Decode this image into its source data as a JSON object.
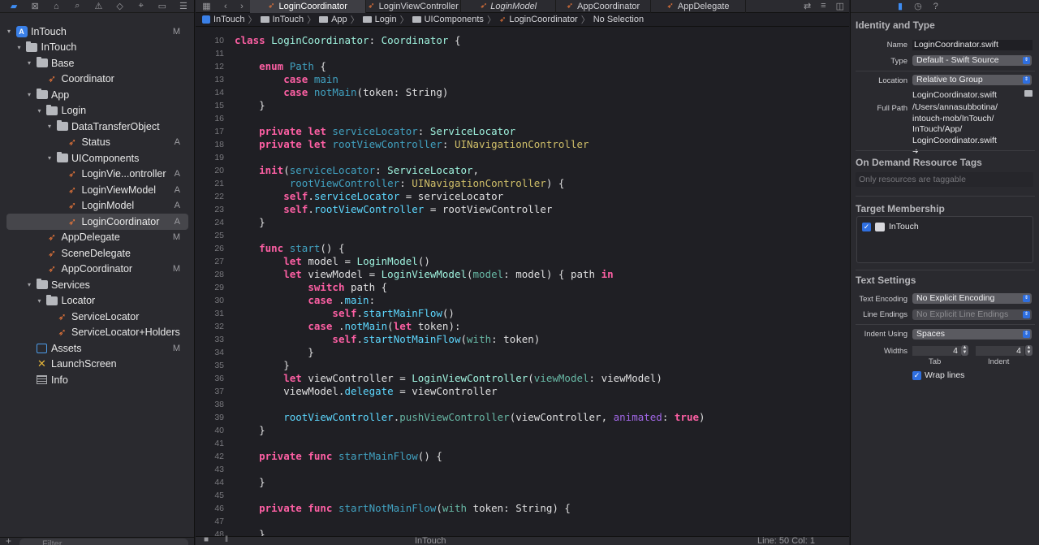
{
  "navigator": {
    "toolbar_icons": [
      "folder-icon",
      "source-control-icon",
      "hierarchy-icon",
      "search-icon",
      "warning-icon",
      "test-icon",
      "debug-icon",
      "breakpoint-icon",
      "report-icon"
    ],
    "items": [
      {
        "name": "InTouch",
        "kind": "project",
        "level": 0,
        "open": true,
        "badge": "M"
      },
      {
        "name": "InTouch",
        "kind": "folder",
        "level": 1,
        "open": true,
        "badge": ""
      },
      {
        "name": "Base",
        "kind": "folder",
        "level": 2,
        "open": true,
        "badge": ""
      },
      {
        "name": "Coordinator",
        "kind": "swift",
        "level": 3,
        "badge": ""
      },
      {
        "name": "App",
        "kind": "folder",
        "level": 2,
        "open": true,
        "badge": ""
      },
      {
        "name": "Login",
        "kind": "folder",
        "level": 3,
        "open": true,
        "badge": ""
      },
      {
        "name": "DataTransferObject",
        "kind": "folder",
        "level": 4,
        "open": true,
        "badge": ""
      },
      {
        "name": "Status",
        "kind": "swift",
        "level": 5,
        "badge": "A"
      },
      {
        "name": "UIComponents",
        "kind": "folder",
        "level": 4,
        "open": true,
        "badge": ""
      },
      {
        "name": "LoginVie...ontroller",
        "kind": "swift",
        "level": 5,
        "badge": "A"
      },
      {
        "name": "LoginViewModel",
        "kind": "swift",
        "level": 5,
        "badge": "A"
      },
      {
        "name": "LoginModel",
        "kind": "swift",
        "level": 5,
        "badge": "A"
      },
      {
        "name": "LoginCoordinator",
        "kind": "swift",
        "level": 5,
        "badge": "A",
        "selected": true
      },
      {
        "name": "AppDelegate",
        "kind": "swift",
        "level": 3,
        "badge": "M"
      },
      {
        "name": "SceneDelegate",
        "kind": "swift",
        "level": 3,
        "badge": ""
      },
      {
        "name": "AppCoordinator",
        "kind": "swift",
        "level": 3,
        "badge": "M"
      },
      {
        "name": "Services",
        "kind": "folder",
        "level": 2,
        "open": true,
        "badge": ""
      },
      {
        "name": "Locator",
        "kind": "folder",
        "level": 3,
        "open": true,
        "badge": ""
      },
      {
        "name": "ServiceLocator",
        "kind": "swift",
        "level": 4,
        "badge": ""
      },
      {
        "name": "ServiceLocator+Holders",
        "kind": "swift",
        "level": 4,
        "badge": ""
      },
      {
        "name": "Assets",
        "kind": "assets",
        "level": 2,
        "badge": "M"
      },
      {
        "name": "LaunchScreen",
        "kind": "launch",
        "level": 2,
        "badge": ""
      },
      {
        "name": "Info",
        "kind": "info",
        "level": 2,
        "badge": ""
      }
    ],
    "filter_placeholder": "Filter"
  },
  "tabs": [
    {
      "label": "LoginCoordinator",
      "active": true,
      "italic": false
    },
    {
      "label": "LoginViewController",
      "active": false,
      "italic": false
    },
    {
      "label": "LoginModel",
      "active": false,
      "italic": true
    },
    {
      "label": "AppCoordinator",
      "active": false,
      "italic": false
    },
    {
      "label": "AppDelegate",
      "active": false,
      "italic": false
    }
  ],
  "jumpbar": [
    {
      "label": "InTouch",
      "kind": "project"
    },
    {
      "label": "InTouch",
      "kind": "folder"
    },
    {
      "label": "App",
      "kind": "folder"
    },
    {
      "label": "Login",
      "kind": "folder"
    },
    {
      "label": "UIComponents",
      "kind": "folder"
    },
    {
      "label": "LoginCoordinator",
      "kind": "swift"
    },
    {
      "label": "No Selection",
      "kind": "text"
    }
  ],
  "code": [
    {
      "n": "10",
      "t": [
        [
          "kw",
          "class "
        ],
        [
          "tycls",
          "LoginCoordinator"
        ],
        [
          "pl",
          ": "
        ],
        [
          "tycls",
          "Coordinator"
        ],
        [
          "pl",
          " {"
        ]
      ]
    },
    {
      "n": "11",
      "t": []
    },
    {
      "n": "12",
      "t": [
        [
          "pl",
          "    "
        ],
        [
          "kw",
          "enum "
        ],
        [
          "dec",
          "Path"
        ],
        [
          "pl",
          " {"
        ]
      ]
    },
    {
      "n": "13",
      "t": [
        [
          "pl",
          "        "
        ],
        [
          "kw",
          "case "
        ],
        [
          "dec",
          "main"
        ]
      ]
    },
    {
      "n": "14",
      "t": [
        [
          "pl",
          "        "
        ],
        [
          "kw",
          "case "
        ],
        [
          "dec",
          "notMain"
        ],
        [
          "pl",
          "(token: String)"
        ]
      ]
    },
    {
      "n": "15",
      "t": [
        [
          "pl",
          "    }"
        ]
      ]
    },
    {
      "n": "16",
      "t": []
    },
    {
      "n": "17",
      "t": [
        [
          "pl",
          "    "
        ],
        [
          "kw",
          "private let "
        ],
        [
          "dec",
          "serviceLocator"
        ],
        [
          "pl",
          ": "
        ],
        [
          "tycls",
          "ServiceLocator"
        ]
      ]
    },
    {
      "n": "18",
      "t": [
        [
          "pl",
          "    "
        ],
        [
          "kw",
          "private let "
        ],
        [
          "dec",
          "rootViewController"
        ],
        [
          "pl",
          ": "
        ],
        [
          "ty",
          "UINavigationController"
        ]
      ]
    },
    {
      "n": "19",
      "t": []
    },
    {
      "n": "20",
      "t": [
        [
          "pl",
          "    "
        ],
        [
          "kw",
          "init"
        ],
        [
          "pl",
          "("
        ],
        [
          "dec",
          "serviceLocator"
        ],
        [
          "pl",
          ": "
        ],
        [
          "tycls",
          "ServiceLocator"
        ],
        [
          "pl",
          ","
        ]
      ]
    },
    {
      "n": "21",
      "t": [
        [
          "pl",
          "         "
        ],
        [
          "dec",
          "rootViewController"
        ],
        [
          "pl",
          ": "
        ],
        [
          "ty",
          "UINavigationController"
        ],
        [
          "pl",
          ") {"
        ]
      ]
    },
    {
      "n": "22",
      "t": [
        [
          "pl",
          "        "
        ],
        [
          "kw",
          "self"
        ],
        [
          "pl",
          "."
        ],
        [
          "ut",
          "serviceLocator"
        ],
        [
          "pl",
          " = serviceLocator"
        ]
      ]
    },
    {
      "n": "23",
      "t": [
        [
          "pl",
          "        "
        ],
        [
          "kw",
          "self"
        ],
        [
          "pl",
          "."
        ],
        [
          "ut",
          "rootViewController"
        ],
        [
          "pl",
          " = rootViewController"
        ]
      ]
    },
    {
      "n": "24",
      "t": [
        [
          "pl",
          "    }"
        ]
      ]
    },
    {
      "n": "25",
      "t": []
    },
    {
      "n": "26",
      "t": [
        [
          "pl",
          "    "
        ],
        [
          "kw",
          "func "
        ],
        [
          "dec",
          "start"
        ],
        [
          "pl",
          "() {"
        ]
      ]
    },
    {
      "n": "27",
      "t": [
        [
          "pl",
          "        "
        ],
        [
          "kw",
          "let "
        ],
        [
          "pl",
          "model = "
        ],
        [
          "tycls",
          "LoginModel"
        ],
        [
          "pl",
          "()"
        ]
      ]
    },
    {
      "n": "28",
      "t": [
        [
          "pl",
          "        "
        ],
        [
          "kw",
          "let "
        ],
        [
          "pl",
          "viewModel = "
        ],
        [
          "tycls",
          "LoginViewModel"
        ],
        [
          "pl",
          "("
        ],
        [
          "fn",
          "model"
        ],
        [
          "pl",
          ": model) { path "
        ],
        [
          "kw",
          "in"
        ]
      ]
    },
    {
      "n": "29",
      "t": [
        [
          "pl",
          "            "
        ],
        [
          "kw",
          "switch "
        ],
        [
          "pl",
          "path {"
        ]
      ]
    },
    {
      "n": "30",
      "t": [
        [
          "pl",
          "            "
        ],
        [
          "kw",
          "case "
        ],
        [
          "pl",
          "."
        ],
        [
          "ut",
          "main"
        ],
        [
          "pl",
          ":"
        ]
      ]
    },
    {
      "n": "31",
      "t": [
        [
          "pl",
          "                "
        ],
        [
          "kw",
          "self"
        ],
        [
          "pl",
          "."
        ],
        [
          "ut",
          "startMainFlow"
        ],
        [
          "pl",
          "()"
        ]
      ]
    },
    {
      "n": "32",
      "t": [
        [
          "pl",
          "            "
        ],
        [
          "kw",
          "case "
        ],
        [
          "pl",
          "."
        ],
        [
          "ut",
          "notMain"
        ],
        [
          "pl",
          "("
        ],
        [
          "kw",
          "let "
        ],
        [
          "pl",
          "token):"
        ]
      ]
    },
    {
      "n": "33",
      "t": [
        [
          "pl",
          "                "
        ],
        [
          "kw",
          "self"
        ],
        [
          "pl",
          "."
        ],
        [
          "ut",
          "startNotMainFlow"
        ],
        [
          "pl",
          "("
        ],
        [
          "fn",
          "with"
        ],
        [
          "pl",
          ": token)"
        ]
      ]
    },
    {
      "n": "34",
      "t": [
        [
          "pl",
          "            }"
        ]
      ]
    },
    {
      "n": "35",
      "t": [
        [
          "pl",
          "        }"
        ]
      ]
    },
    {
      "n": "36",
      "t": [
        [
          "pl",
          "        "
        ],
        [
          "kw",
          "let "
        ],
        [
          "pl",
          "viewController = "
        ],
        [
          "tycls",
          "LoginViewController"
        ],
        [
          "pl",
          "("
        ],
        [
          "fn",
          "viewModel"
        ],
        [
          "pl",
          ": viewModel)"
        ]
      ]
    },
    {
      "n": "37",
      "t": [
        [
          "pl",
          "        viewModel."
        ],
        [
          "ut",
          "delegate"
        ],
        [
          "pl",
          " = viewController"
        ]
      ]
    },
    {
      "n": "38",
      "t": []
    },
    {
      "n": "39",
      "t": [
        [
          "pl",
          "        "
        ],
        [
          "ut",
          "rootViewController"
        ],
        [
          "pl",
          "."
        ],
        [
          "fn",
          "pushViewController"
        ],
        [
          "pl",
          "(viewController, "
        ],
        [
          "case",
          "animated"
        ],
        [
          "pl",
          ": "
        ],
        [
          "kw",
          "true"
        ],
        [
          "pl",
          ")"
        ]
      ]
    },
    {
      "n": "40",
      "t": [
        [
          "pl",
          "    }"
        ]
      ]
    },
    {
      "n": "41",
      "t": []
    },
    {
      "n": "42",
      "t": [
        [
          "pl",
          "    "
        ],
        [
          "kw",
          "private func "
        ],
        [
          "dec",
          "startMainFlow"
        ],
        [
          "pl",
          "() {"
        ]
      ]
    },
    {
      "n": "43",
      "t": []
    },
    {
      "n": "44",
      "t": [
        [
          "pl",
          "    }"
        ]
      ]
    },
    {
      "n": "45",
      "t": []
    },
    {
      "n": "46",
      "t": [
        [
          "pl",
          "    "
        ],
        [
          "kw",
          "private func "
        ],
        [
          "dec",
          "startNotMainFlow"
        ],
        [
          "pl",
          "("
        ],
        [
          "fn",
          "with "
        ],
        [
          "pl",
          "token: String) {"
        ]
      ]
    },
    {
      "n": "47",
      "t": []
    },
    {
      "n": "48",
      "t": [
        [
          "pl",
          "    }"
        ]
      ]
    }
  ],
  "editor_status": {
    "scheme": "InTouch",
    "position": "Line: 50  Col: 1"
  },
  "inspector": {
    "identity_title": "Identity and Type",
    "name_label": "Name",
    "name_value": "LoginCoordinator.swift",
    "type_label": "Type",
    "type_value": "Default - Swift Source",
    "location_label": "Location",
    "location_value": "Relative to Group",
    "location_file": "LoginCoordinator.swift",
    "fullpath_label": "Full Path",
    "fullpath_lines": [
      "/Users/annasubbotina/",
      "intouch-mob/InTouch/",
      "InTouch/App/",
      "LoginCoordinator.swift"
    ],
    "odr_title": "On Demand Resource Tags",
    "odr_placeholder": "Only resources are taggable",
    "target_title": "Target Membership",
    "target_name": "InTouch",
    "text_title": "Text Settings",
    "encoding_label": "Text Encoding",
    "encoding_value": "No Explicit Encoding",
    "line_endings_label": "Line Endings",
    "line_endings_value": "No Explicit Line Endings",
    "indent_label": "Indent Using",
    "indent_value": "Spaces",
    "widths_label": "Widths",
    "tab_value": "4",
    "indent_width_value": "4",
    "tab_caption": "Tab",
    "indent_caption": "Indent",
    "wrap_label": "Wrap lines"
  }
}
